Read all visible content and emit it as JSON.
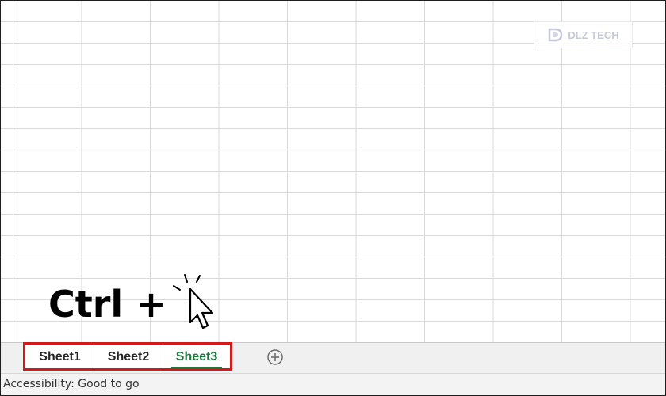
{
  "watermark": {
    "text": "DLZ TECH",
    "icon": "dlz-logo-icon"
  },
  "overlay": {
    "shortcut_text": "Ctrl +",
    "cursor_icon": "click-cursor-icon"
  },
  "sheet_tabs": {
    "tabs": [
      {
        "label": "Sheet1",
        "active": false
      },
      {
        "label": "Sheet2",
        "active": false
      },
      {
        "label": "Sheet3",
        "active": true
      }
    ],
    "active_color": "#1d7a3f",
    "highlight_color": "#d11b1b",
    "add_icon": "plus-circle-icon"
  },
  "status_bar": {
    "text": "Accessibility: Good to go"
  }
}
